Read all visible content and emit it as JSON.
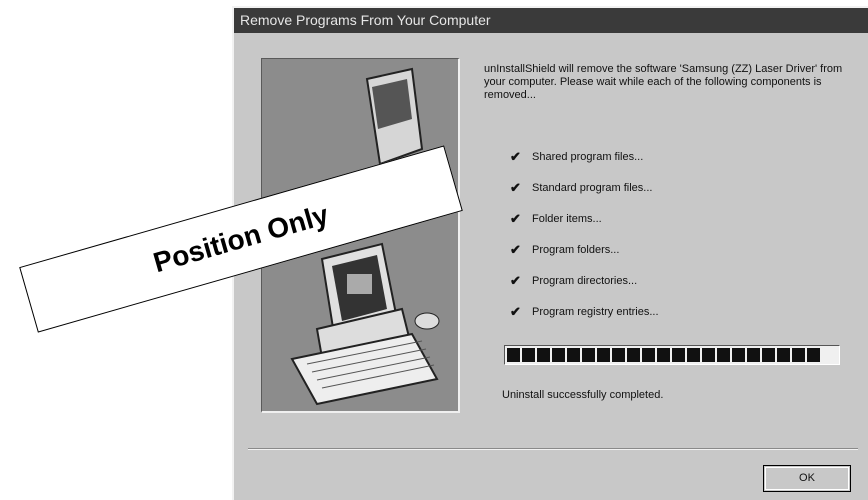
{
  "dialog": {
    "title": "Remove Programs From Your Computer",
    "message": "unInstallShield will remove the software 'Samsung (ZZ) Laser Driver' from your computer. Please wait while each of the following components is removed...",
    "steps": [
      {
        "label": "Shared program files...",
        "done": true
      },
      {
        "label": "Standard program files...",
        "done": true
      },
      {
        "label": "Folder items...",
        "done": true
      },
      {
        "label": "Program folders...",
        "done": true
      },
      {
        "label": "Program directories...",
        "done": true
      },
      {
        "label": "Program registry entries...",
        "done": true
      }
    ],
    "check_glyph": "✔",
    "progress": {
      "fraction": 1.0,
      "blocks": 21
    },
    "status": "Uninstall successfully completed.",
    "ok_label": "OK"
  },
  "overlay": {
    "label": "Position Only"
  },
  "icons": {
    "check": "checkmark-icon",
    "illustration": "computer-illustration"
  }
}
